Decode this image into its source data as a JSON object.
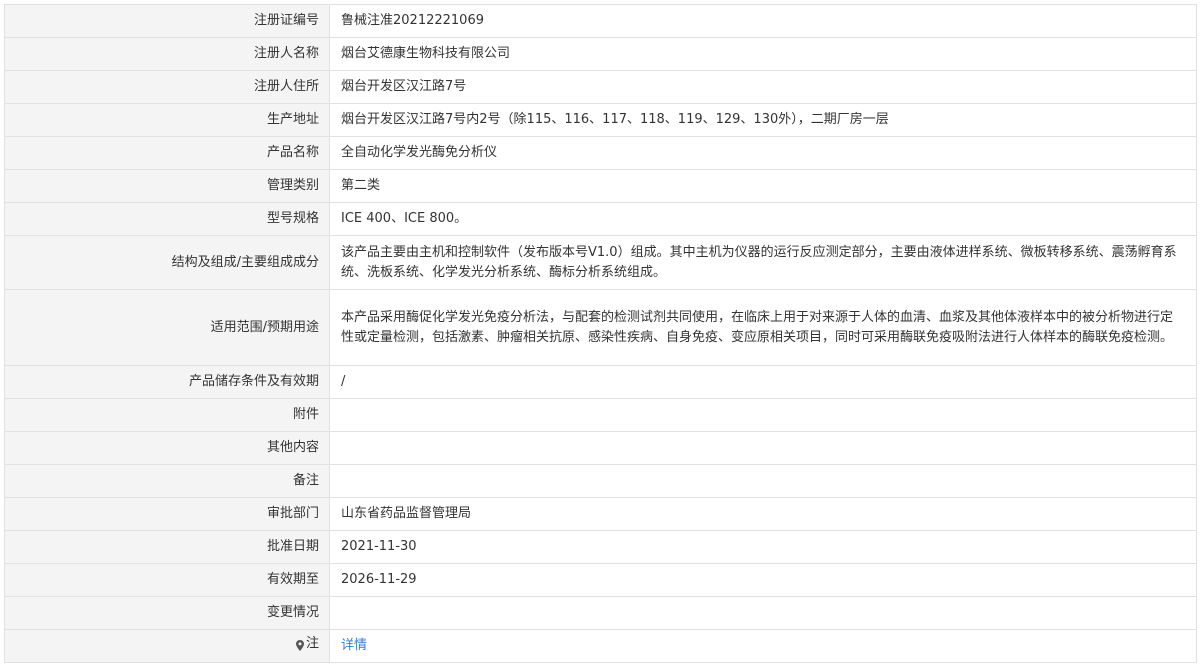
{
  "colors": {
    "label_background": "#f4f4f4",
    "border": "#e1e1e1",
    "text": "#333333",
    "link": "#2f7fd8"
  },
  "rows": [
    {
      "label": "注册证编号",
      "value": "鲁械注准20212221069"
    },
    {
      "label": "注册人名称",
      "value": "烟台艾德康生物科技有限公司"
    },
    {
      "label": "注册人住所",
      "value": "烟台开发区汉江路7号"
    },
    {
      "label": "生产地址",
      "value": "烟台开发区汉江路7号内2号（除115、116、117、118、119、129、130外），二期厂房一层"
    },
    {
      "label": "产品名称",
      "value": "全自动化学发光酶免分析仪"
    },
    {
      "label": "管理类别",
      "value": "第二类"
    },
    {
      "label": "型号规格",
      "value": "ICE 400、ICE 800。"
    },
    {
      "label": "结构及组成/主要组成成分",
      "value": "该产品主要由主机和控制软件（发布版本号V1.0）组成。其中主机为仪器的运行反应测定部分，主要由液体进样系统、微板转移系统、震荡孵育系统、洗板系统、化学发光分析系统、酶标分析系统组成。"
    },
    {
      "label": "适用范围/预期用途",
      "value": "本产品采用酶促化学发光免疫分析法，与配套的检测试剂共同使用，在临床上用于对来源于人体的血清、血浆及其他体液样本中的被分析物进行定性或定量检测，包括激素、肿瘤相关抗原、感染性疾病、自身免疫、变应原相关项目，同时可采用酶联免疫吸附法进行人体样本的酶联免疫检测。"
    },
    {
      "label": "产品储存条件及有效期",
      "value": "/"
    },
    {
      "label": "附件",
      "value": ""
    },
    {
      "label": "其他内容",
      "value": ""
    },
    {
      "label": "备注",
      "value": ""
    },
    {
      "label": "审批部门",
      "value": "山东省药品监督管理局"
    },
    {
      "label": "批准日期",
      "value": "2021-11-30"
    },
    {
      "label": "有效期至",
      "value": "2026-11-29"
    },
    {
      "label": "变更情况",
      "value": ""
    }
  ],
  "note_row": {
    "label": "注",
    "icon": "map-pin-icon",
    "link_text": "详情"
  }
}
